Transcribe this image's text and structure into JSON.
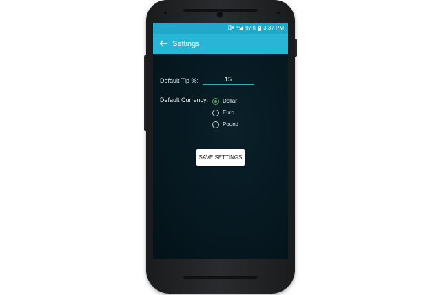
{
  "status_bar": {
    "battery": "97%",
    "time": "3:37 PM",
    "icons": [
      "mute-icon",
      "signal-icon",
      "battery-icon"
    ],
    "color": "#1fa8c9"
  },
  "app_bar": {
    "title": "Settings",
    "back_icon": "back-arrow-icon",
    "color": "#28b5d6"
  },
  "form": {
    "tip_label": "Default Tip %:",
    "tip_value": "15",
    "currency_label": "Default Currency:",
    "currency_options": [
      "Dollar",
      "Euro",
      "Pound"
    ],
    "selected_currency": "Dollar",
    "accent_color": "#4caf50"
  },
  "actions": {
    "save_label": "SAVE SETTINGS"
  }
}
